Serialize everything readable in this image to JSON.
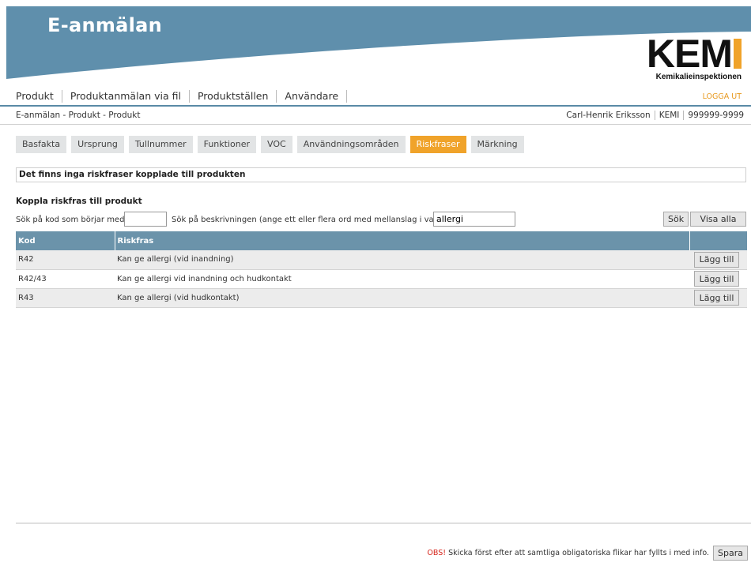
{
  "app": {
    "title": "E-anmälan"
  },
  "logo": {
    "word": "KEM",
    "subtitle": "Kemikalieinspektionen"
  },
  "mainnav": {
    "items": [
      "Produkt",
      "Produktanmälan via fil",
      "Produktställen",
      "Användare"
    ],
    "logout": "LOGGA UT"
  },
  "breadcrumb": "E-anmälan - Produkt - Produkt",
  "user": {
    "name": "Carl-Henrik Eriksson",
    "org": "KEMI",
    "id": "999999-9999"
  },
  "tabs": {
    "items": [
      "Basfakta",
      "Ursprung",
      "Tullnummer",
      "Funktioner",
      "VOC",
      "Användningsområden",
      "Riskfraser",
      "Märkning"
    ],
    "active": "Riskfraser"
  },
  "notice": "Det finns inga riskfraser kopplade till produkten",
  "link_section": {
    "title": "Koppla riskfras till produkt",
    "code_label": "Sök på kod som börjar med:",
    "code_value": "",
    "desc_label": "Sök på beskrivningen (ange ett eller flera ord med mellanslag i varje)",
    "desc_value": "allergi",
    "search_button": "Sök",
    "show_all_button": "Visa alla"
  },
  "table": {
    "headers": [
      "Kod",
      "Riskfras",
      ""
    ],
    "rows": [
      {
        "code": "R42",
        "phrase": "Kan ge allergi (vid inandning)",
        "action": "Lägg till"
      },
      {
        "code": "R42/43",
        "phrase": "Kan ge allergi vid inandning och hudkontakt",
        "action": "Lägg till"
      },
      {
        "code": "R43",
        "phrase": "Kan ge allergi (vid hudkontakt)",
        "action": "Lägg till"
      }
    ]
  },
  "footer": {
    "obs": "OBS!",
    "message": "Skicka först efter att samtliga obligatoriska flikar har fyllts i med info.",
    "save_button": "Spara"
  },
  "colors": {
    "header_blue": "#5f8fac",
    "accent_orange": "#f0a32a",
    "table_header": "#6b93aa",
    "obs_red": "#d6261c"
  }
}
